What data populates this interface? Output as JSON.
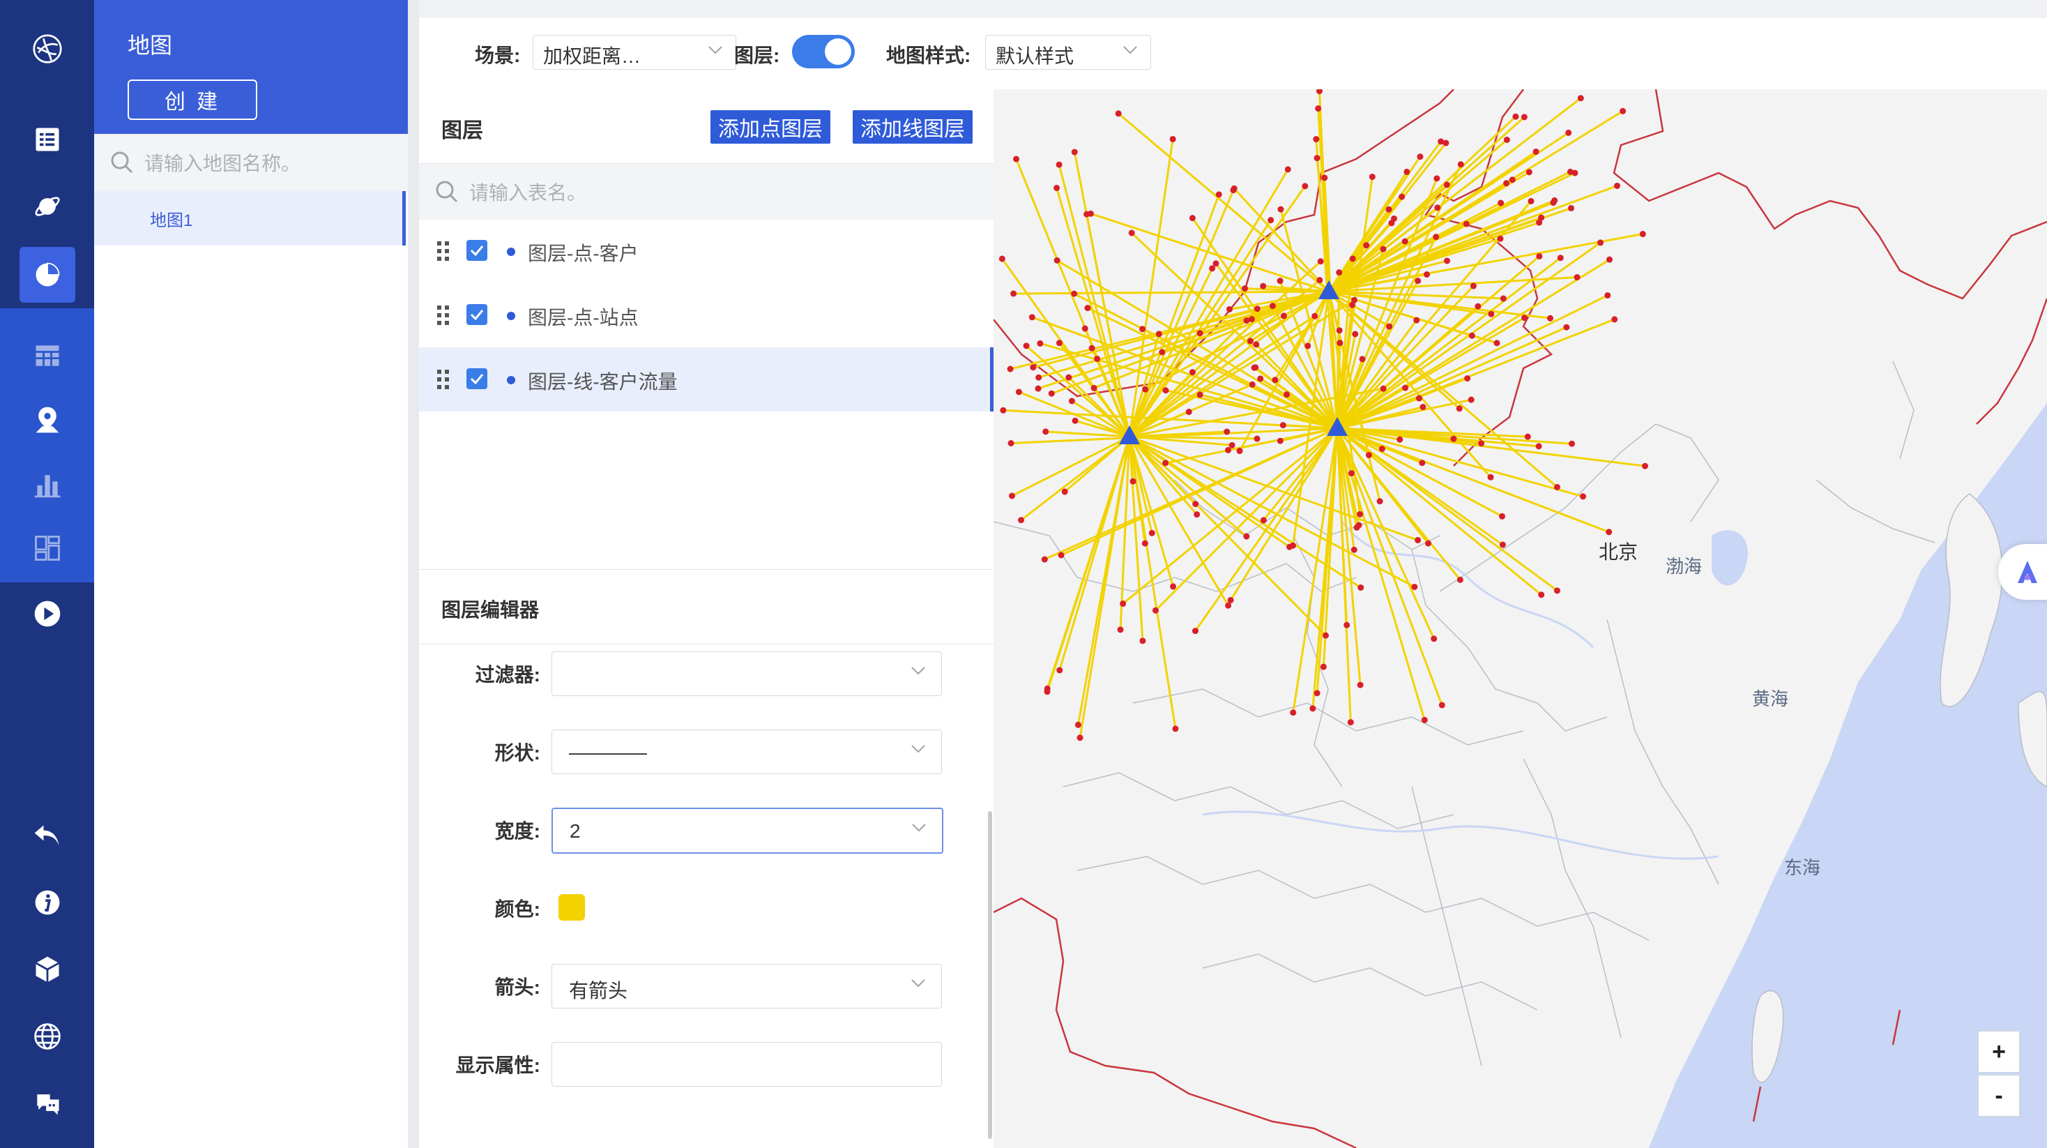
{
  "nav": {
    "items": [
      {
        "icon": "task-list-icon"
      },
      {
        "icon": "planet-icon"
      },
      {
        "icon": "pie-chart-icon",
        "active": true
      },
      {
        "icon": "table-grid-icon"
      },
      {
        "icon": "map-pin-icon"
      },
      {
        "icon": "bar-chart-icon"
      },
      {
        "icon": "dashboard-icon"
      },
      {
        "icon": "play-icon"
      },
      {
        "icon": "undo-icon"
      },
      {
        "icon": "info-icon"
      },
      {
        "icon": "cube-icon"
      },
      {
        "icon": "globe-icon"
      },
      {
        "icon": "chat-icon"
      }
    ]
  },
  "map_list": {
    "title": "地图",
    "create_label": "创 建",
    "search_placeholder": "请输入地图名称。",
    "items": [
      "地图1"
    ]
  },
  "toolbar": {
    "scene_label": "场景:",
    "scene_value": "加权距离…",
    "layer_label": "图层:",
    "layer_toggle_on": true,
    "style_label": "地图样式:",
    "style_value": "默认样式"
  },
  "layers": {
    "title": "图层",
    "add_point_label": "添加点图层",
    "add_line_label": "添加线图层",
    "search_placeholder": "请输入表名。",
    "items": [
      {
        "name": "图层-点-客户",
        "checked": true
      },
      {
        "name": "图层-点-站点",
        "checked": true
      },
      {
        "name": "图层-线-客户流量",
        "checked": true,
        "selected": true
      }
    ]
  },
  "editor": {
    "title": "图层编辑器",
    "filter_label": "过滤器:",
    "filter_value": "",
    "shape_label": "形状:",
    "shape_value": "————",
    "width_label": "宽度:",
    "width_value": "2",
    "color_label": "颜色:",
    "color_value": "#f2d300",
    "arrow_label": "箭头:",
    "arrow_value": "有箭头",
    "display_attr_label": "显示属性:",
    "display_attr_value": ""
  },
  "map": {
    "labels": {
      "beijing": "北京",
      "bohai": "渤海",
      "yellow_sea": "黄海",
      "east_sea": "东海"
    },
    "zoom_in": "+",
    "zoom_out": "-",
    "line_color": "#f2d300",
    "point_color": "#d8202a",
    "hub_color": "#2f5bd8"
  }
}
